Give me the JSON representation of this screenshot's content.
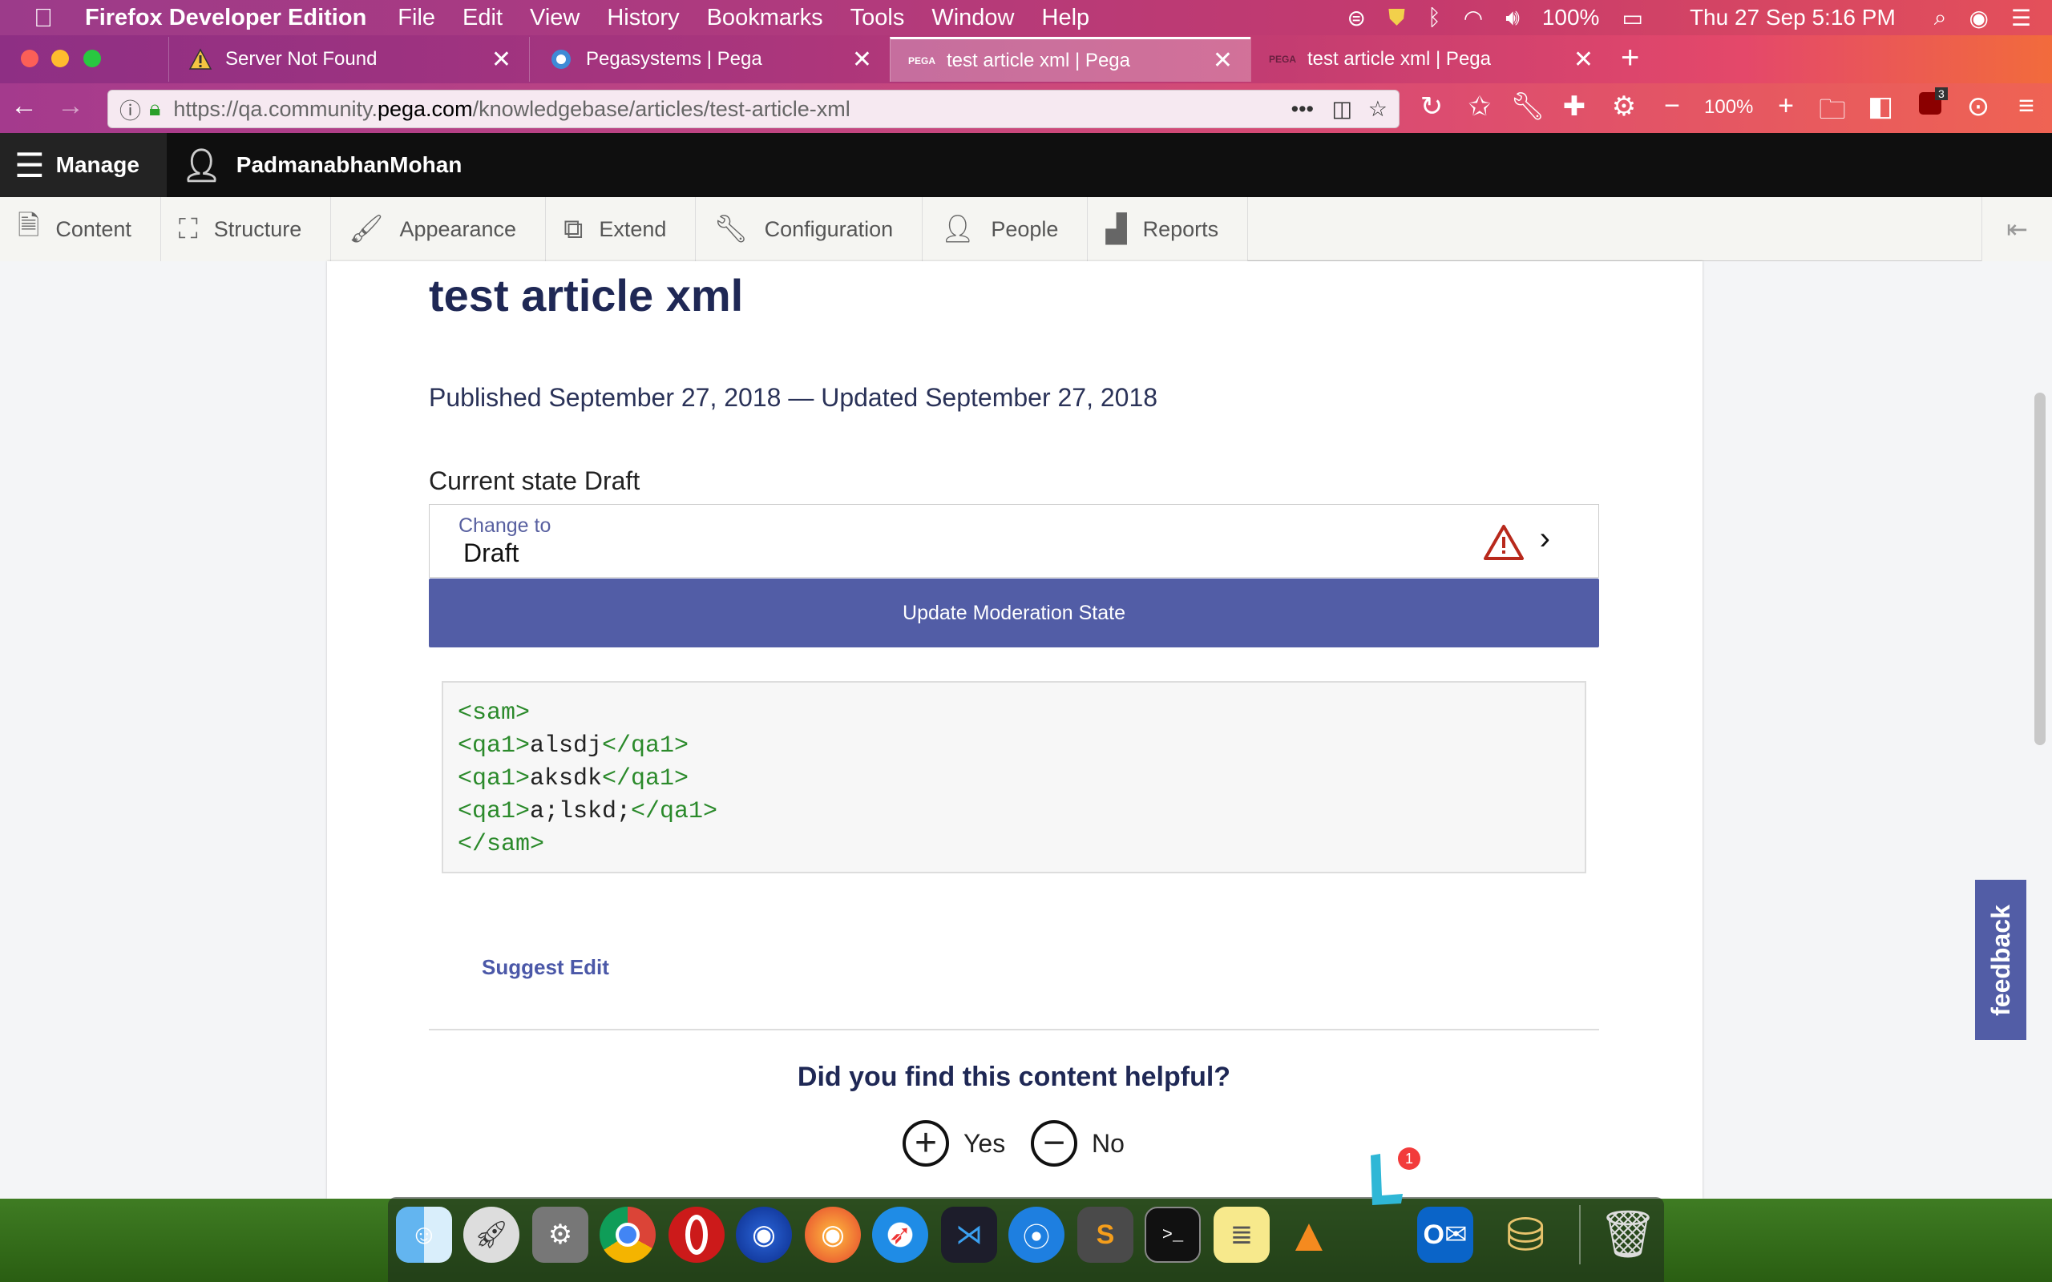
{
  "menubar": {
    "app_name": "Firefox Developer Edition",
    "items": [
      "File",
      "Edit",
      "View",
      "History",
      "Bookmarks",
      "Tools",
      "Window",
      "Help"
    ],
    "battery": "100%",
    "datetime": "Thu 27 Sep  5:16 PM"
  },
  "tabs": [
    {
      "label": "Server Not Found",
      "icon": "warning-icon"
    },
    {
      "label": "Pegasystems | Pega",
      "icon": "pega-icon"
    },
    {
      "label": "test article xml | Pega",
      "icon": "pega-icon",
      "favicon_text": "PEGA",
      "active": true
    },
    {
      "label": "test article xml | Pega",
      "icon": "pega-icon",
      "favicon_text": "PEGA"
    }
  ],
  "toolbar": {
    "url_prefix": "https://qa.community.",
    "url_host": "pega.com",
    "url_path": "/knowledgebase/articles/test-article-xml",
    "zoom": "100%",
    "badge_count": "3"
  },
  "admin": {
    "manage_label": "Manage",
    "user_name": "PadmanabhanMohan",
    "tray": [
      "Content",
      "Structure",
      "Appearance",
      "Extend",
      "Configuration",
      "People",
      "Reports"
    ]
  },
  "article": {
    "title": "test article xml",
    "published": "Published September 27, 2018 — Updated September 27, 2018",
    "current_state": "Current state Draft",
    "change_to_label": "Change to",
    "change_to_value": "Draft",
    "update_button": "Update Moderation State",
    "code_lines": [
      {
        "open": "<sam>",
        "text": "",
        "close": ""
      },
      {
        "open": "<qa1>",
        "text": "alsdj",
        "close": "</qa1>"
      },
      {
        "open": "<qa1>",
        "text": "aksdk",
        "close": "</qa1>"
      },
      {
        "open": "<qa1>",
        "text": "a;lskd;",
        "close": "</qa1>"
      },
      {
        "open": "</sam>",
        "text": "",
        "close": ""
      }
    ],
    "suggest_edit": "Suggest Edit",
    "helpful_question": "Did you find this content helpful?",
    "yes": "Yes",
    "no": "No",
    "feedback_tab": "feedback"
  },
  "dock": {
    "notification_count": "1"
  },
  "colors": {
    "accent": "#525da6",
    "title": "#1f2855",
    "code_tag": "#2b8a2b"
  }
}
